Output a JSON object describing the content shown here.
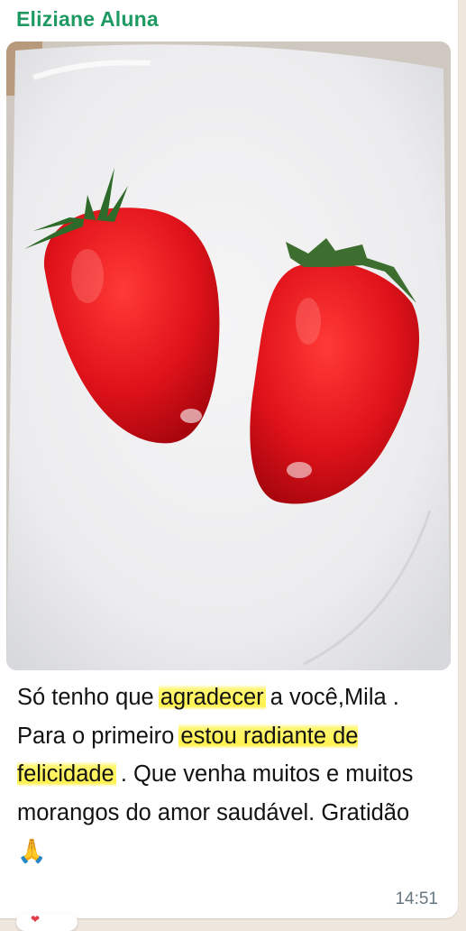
{
  "message": {
    "sender_name": "Eliziane Aluna",
    "photo_alt": "strawberries-photo",
    "text_parts": {
      "p1": "Só tenho que ",
      "h1": "agradecer",
      "p2": " a você,Mila . Para o primeiro ",
      "h2": "estou radiante de felicidade",
      "p3": " . Que venha muitos e muitos morangos do amor saudável. Gratidão ",
      "emoji": "🙏"
    },
    "timestamp": "14:51",
    "reaction_emoji": "❤"
  },
  "colors": {
    "sender": "#1f9a63",
    "highlight": "#fff03c",
    "bubble": "#ffffff",
    "chat_background": "#efe7de"
  }
}
